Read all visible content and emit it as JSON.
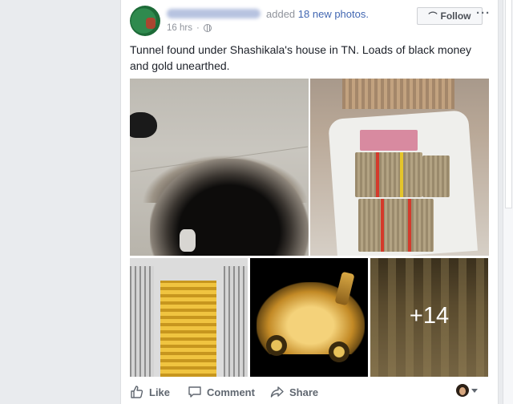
{
  "post": {
    "headline_added": "added",
    "headline_link": "18 new photos.",
    "time": "16 hrs",
    "separator": "·",
    "follow_label": "Follow",
    "more_label": "···",
    "text": "Tunnel found under Shashikala's house in TN. Loads of black money and gold unearthed.",
    "more_photos_count": "+14"
  },
  "actions": {
    "like": "Like",
    "comment": "Comment",
    "share": "Share"
  },
  "icons": [
    "globe-icon",
    "rss-icon",
    "like-icon",
    "comment-icon",
    "share-icon",
    "chevron-down-icon"
  ],
  "colors": {
    "link": "#4267b2",
    "meta": "#90949c",
    "action": "#606770",
    "background": "#e9ebee"
  }
}
